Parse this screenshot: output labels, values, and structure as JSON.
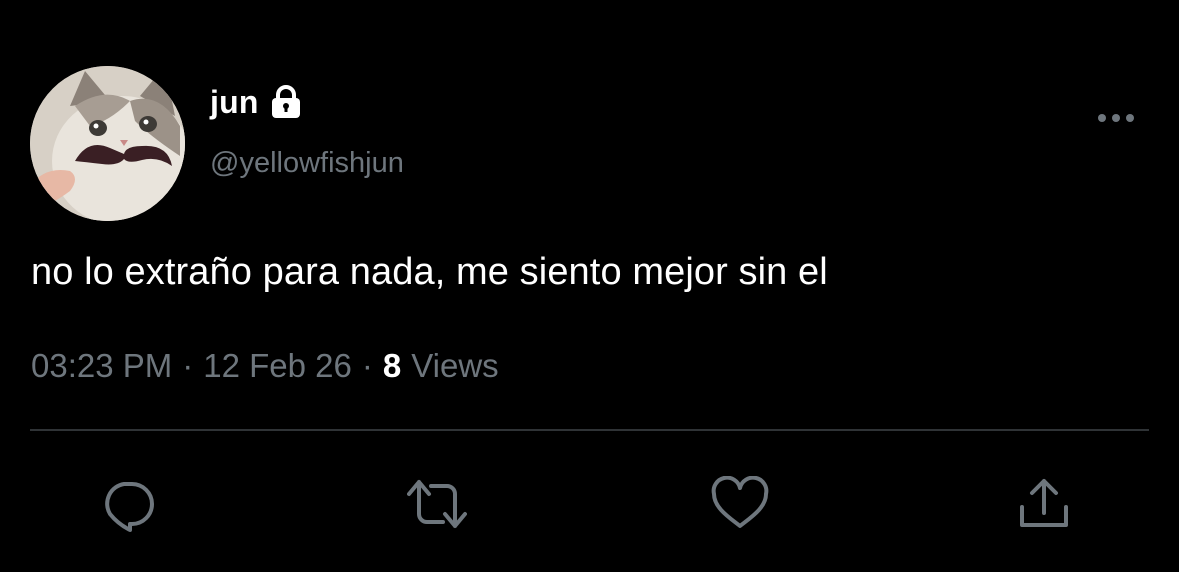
{
  "user": {
    "display_name": "jun",
    "handle": "@yellowfishjun",
    "protected_icon": "lock-icon",
    "avatar_icon": "cat-with-mustache-avatar"
  },
  "tweet": {
    "text": "no lo extraño para nada, me siento mejor sin el"
  },
  "meta": {
    "time": "03:23 PM",
    "separator": "·",
    "date": "12 Feb 26",
    "views_count": "8",
    "views_label": "Views"
  },
  "actions": [
    {
      "name": "reply",
      "icon": "reply-icon"
    },
    {
      "name": "retweet",
      "icon": "retweet-icon"
    },
    {
      "name": "like",
      "icon": "heart-icon"
    },
    {
      "name": "share",
      "icon": "share-icon"
    }
  ],
  "colors": {
    "background": "#000000",
    "primary_text": "#ffffff",
    "secondary_text": "#6e767d",
    "divider": "#2f3336"
  }
}
